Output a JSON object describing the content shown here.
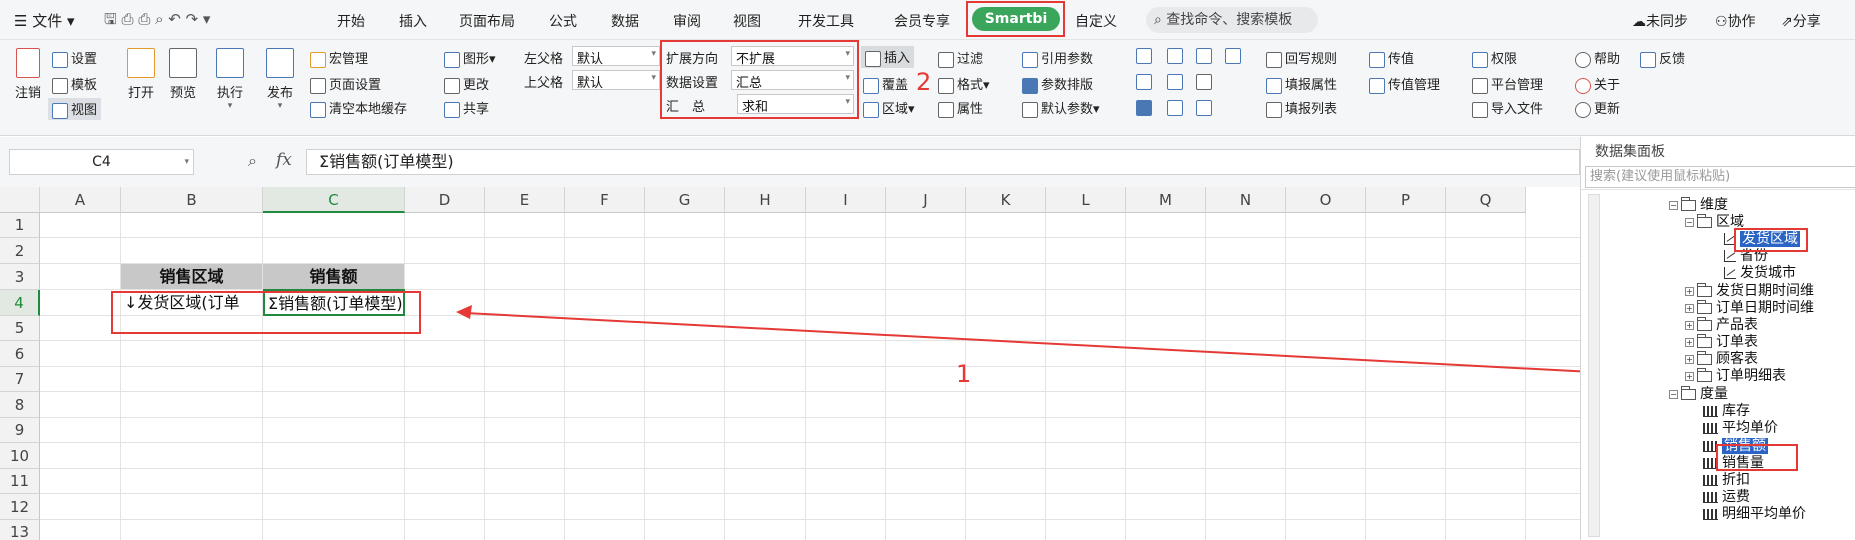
{
  "topbar": {
    "menu_file": "文件",
    "tabs": [
      "开始",
      "插入",
      "页面布局",
      "公式",
      "数据",
      "审阅",
      "视图",
      "开发工具",
      "会员专享",
      "Smartbi",
      "自定义"
    ],
    "search": "查找命令、搜索模板",
    "sync": "未同步",
    "collab": "协作",
    "share": "分享"
  },
  "ribbon": {
    "logout": "注销",
    "settings": "设置",
    "template": "模板",
    "view": "视图",
    "open": "打开",
    "preview": "预览",
    "execute": "执行",
    "publish": "发布",
    "macro": "宏管理",
    "page_setup": "页面设置",
    "clear_cache": "清空本地缓存",
    "chart": "图形",
    "change": "更改",
    "share": "共享",
    "left_parent_label": "左父格",
    "left_parent_value": "默认",
    "top_parent_label": "上父格",
    "top_parent_value": "默认",
    "expand_dir_label": "扩展方向",
    "expand_dir_value": "不扩展",
    "data_set_label": "数据设置",
    "data_set_value": "汇总",
    "summary_label": "汇　总",
    "summary_value": "求和",
    "insert": "插入",
    "overwrite": "覆盖",
    "region": "区域",
    "filter": "过滤",
    "format": "格式",
    "property": "属性",
    "ref_param": "引用参数",
    "param_layout": "参数排版",
    "default_param": "默认参数",
    "writeback": "回写规则",
    "fill_prop": "填报属性",
    "fill_list": "填报列表",
    "transfer": "传值",
    "transfer_mgr": "传值管理",
    "permission": "权限",
    "platform_mgr": "平台管理",
    "import_file": "导入文件",
    "help": "帮助",
    "feedback": "反馈",
    "about": "关于",
    "update": "更新"
  },
  "formula": {
    "cell_ref": "C4",
    "fx": "fx",
    "content": "Σ销售额(订单模型)"
  },
  "grid": {
    "columns": [
      "A",
      "B",
      "C",
      "D",
      "E",
      "F",
      "G",
      "H",
      "I",
      "J",
      "K",
      "L",
      "M",
      "N",
      "O",
      "P",
      "Q"
    ],
    "rows": [
      "1",
      "2",
      "3",
      "4",
      "5",
      "6",
      "7",
      "8",
      "9",
      "10",
      "11",
      "12",
      "13"
    ],
    "b3": "销售区域",
    "c3": "销售额",
    "b4": "↓发货区域(订单",
    "c4": "Σ销售额(订单模型)"
  },
  "annotations": {
    "num1": "1",
    "num2": "2"
  },
  "panel": {
    "title": "数据集面板",
    "search_placeholder": "搜索(建议使用鼠标粘贴)",
    "nodes": {
      "dim": "维度",
      "region": "区域",
      "ship_region": "发货区域",
      "province": "省份",
      "ship_city": "发货城市",
      "ship_date": "发货日期时间维",
      "order_date": "订单日期时间维",
      "product": "产品表",
      "order": "订单表",
      "customer": "顾客表",
      "order_detail": "订单明细表",
      "measure": "度量",
      "stock": "库存",
      "avg_price": "平均单价",
      "sales": "销售额",
      "sales_qty": "销售量",
      "discount": "折扣",
      "freight": "运费",
      "detail_avg": "明细平均单价"
    }
  }
}
